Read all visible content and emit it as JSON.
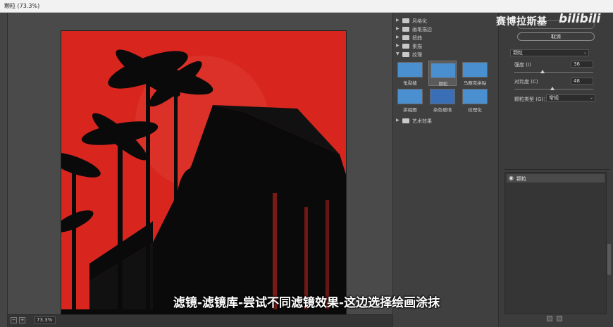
{
  "window": {
    "title": "颗粒 (73.3%)"
  },
  "preview": {
    "zoom": "73.3%",
    "zoom_out_symbol": "−",
    "zoom_in_symbol": "+"
  },
  "gallery": {
    "folders": [
      {
        "label": "风格化",
        "expanded": false
      },
      {
        "label": "画笔描边",
        "expanded": false
      },
      {
        "label": "扭曲",
        "expanded": false
      },
      {
        "label": "素描",
        "expanded": false
      },
      {
        "label": "纹理",
        "expanded": true
      }
    ],
    "texture_filters": [
      {
        "label": "龟裂缝",
        "selected": false
      },
      {
        "label": "颗粒",
        "selected": true
      },
      {
        "label": "马赛克拼贴",
        "selected": false
      },
      {
        "label": "拼缀图",
        "selected": false
      },
      {
        "label": "染色玻璃",
        "selected": false
      },
      {
        "label": "纹理化",
        "selected": false
      }
    ],
    "art_folder": {
      "label": "艺术效果",
      "expanded": false
    }
  },
  "settings": {
    "cancel_label": "取消",
    "filter_name": "颗粒",
    "intensity_label": "强度 (I)",
    "intensity_value": "36",
    "intensity_fraction": 0.36,
    "contrast_label": "对比度 (C)",
    "contrast_value": "48",
    "contrast_fraction": 0.48,
    "grain_type_label": "颗粒类型 (G)：",
    "grain_type_value": "常规"
  },
  "layers": [
    {
      "name": "颗粒"
    }
  ],
  "overlay": {
    "watermark": "赛博拉斯基",
    "bili_logo": "bilibili",
    "subtitle": "滤镜-滤镜库-尝试不同滤镜效果-这边选择绘画涂抹"
  },
  "colors": {
    "preview_red": "#d8261f",
    "silhouette": "#0a0a0a"
  }
}
